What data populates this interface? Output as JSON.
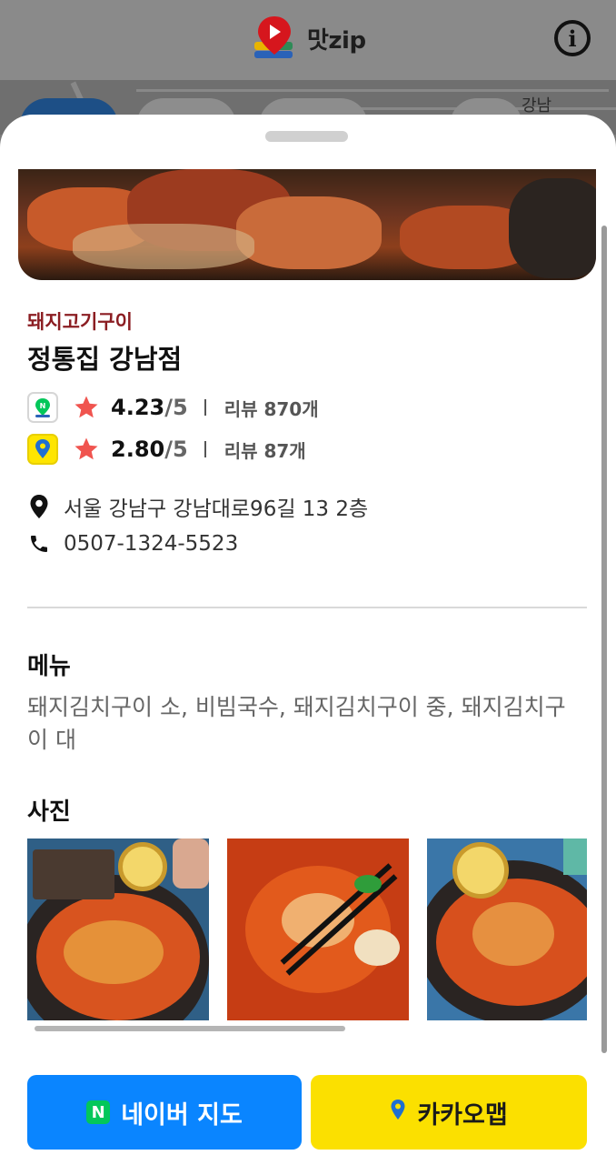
{
  "app": {
    "title": "맛zip",
    "info_icon": "info-icon",
    "logo_icon": "map-pin-play-logo"
  },
  "map": {
    "label": "강남"
  },
  "restaurant": {
    "category": "돼지고기구이",
    "name": "정통집 강남점",
    "ratings": [
      {
        "source_icon": "naver-map-icon",
        "score": "4.23",
        "max": "/5",
        "reviews": "리뷰 870개"
      },
      {
        "source_icon": "kakao-map-icon",
        "score": "2.80",
        "max": "/5",
        "reviews": "리뷰 87개"
      }
    ],
    "address": "서울 강남구 강남대로96길 13 2층",
    "phone": "0507-1324-5523"
  },
  "menu": {
    "title": "메뉴",
    "items": "돼지김치구이 소, 비빔국수, 돼지김치구이 중, 돼지김치구이 대"
  },
  "photos": {
    "title": "사진",
    "count": 3
  },
  "actions": {
    "naver_label": "네이버 지도",
    "naver_badge": "N",
    "kakao_label": "카카오맵"
  },
  "colors": {
    "category": "#8b1d22",
    "star": "#f0544f",
    "naver_button": "#0a85ff",
    "kakao_button": "#fbe000",
    "naver_green": "#03c75a"
  }
}
